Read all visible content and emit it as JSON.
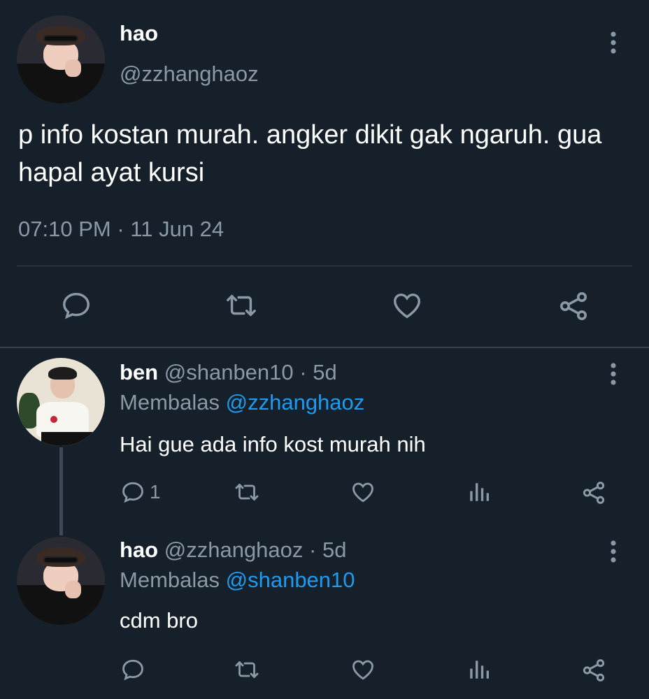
{
  "main_tweet": {
    "author_name": "hao",
    "author_handle": "@zzhanghaoz",
    "text": "p info kostan murah. angker dikit gak ngaruh. gua hapal ayat kursi",
    "time": "07:10 PM",
    "separator_dot": "·",
    "date": "11 Jun 24",
    "actions": [
      "reply-icon",
      "retweet-icon",
      "like-icon",
      "share-icon"
    ]
  },
  "replies": [
    {
      "author_name": "ben",
      "author_handle": "@shanben10",
      "dot": "·",
      "age": "5d",
      "replying_prefix": "Membalas",
      "replying_to": "@zzhanghaoz",
      "text": "Hai gue ada info kost murah nih",
      "reply_count": "1"
    },
    {
      "author_name": "hao",
      "author_handle": "@zzhanghaoz",
      "dot": "·",
      "age": "5d",
      "replying_prefix": "Membalas",
      "replying_to": "@shanben10",
      "text": "cdm bro",
      "reply_count": ""
    }
  ],
  "colors": {
    "background": "#15202b",
    "text": "#ffffff",
    "secondary": "#8b98a5",
    "link": "#1d9bf0",
    "divider": "#38444d"
  }
}
